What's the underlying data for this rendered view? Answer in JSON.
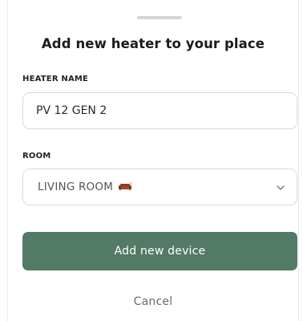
{
  "sheet": {
    "title": "Add new heater to your place"
  },
  "form": {
    "heater_name": {
      "label": "HEATER NAME",
      "value": "PV 12 GEN 2"
    },
    "room": {
      "label": "ROOM",
      "selected": "LIVING ROOM",
      "icon": "sofa-emoji"
    }
  },
  "actions": {
    "primary_label": "Add new device",
    "cancel_label": "Cancel"
  },
  "colors": {
    "primary_button": "#537a66",
    "field_border": "#d9dbe3",
    "grabber": "#d7d4d1"
  }
}
